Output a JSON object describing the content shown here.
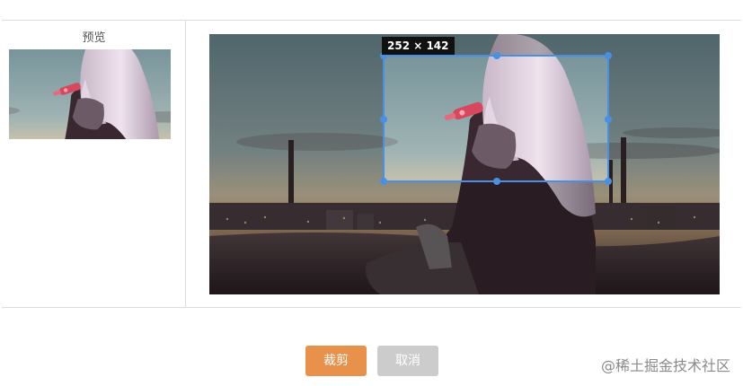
{
  "preview": {
    "title": "预览"
  },
  "cropper": {
    "size_label": "252 × 142",
    "accent_color": "#4a90e2"
  },
  "buttons": {
    "crop_label": "裁剪",
    "cancel_label": "取消",
    "crop_color": "#e8914a",
    "cancel_color": "#cccccc"
  },
  "watermark": {
    "text": "@稀土掘金技术社区"
  }
}
